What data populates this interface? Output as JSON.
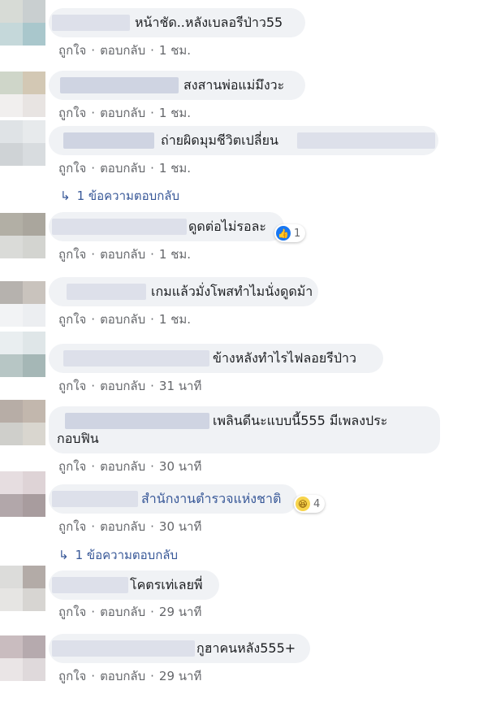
{
  "actions": {
    "like": "ถูกใจ",
    "reply": "ตอบกลับ",
    "sep": "·"
  },
  "comments": [
    {
      "text": "หน้าชัด..หลังเบลอรีป่าว55",
      "time": "1 ชม."
    },
    {
      "text": "สงสานพ่อแม่มึงวะ",
      "time": "1 ชม."
    },
    {
      "text": "ถ่ายผิดมุมชีวิตเปลี่ยน",
      "time": "1 ชม.",
      "replies": "1 ข้อความตอบกลับ"
    },
    {
      "text": "ดูดต่อไม่รอละ",
      "time": "1 ชม.",
      "reaction": {
        "icon": "like-icon",
        "count": "1"
      }
    },
    {
      "text": "เกมแล้วมั่งโพสทำไมนั่งดูดม้า",
      "time": "1 ชม."
    },
    {
      "text": "ข้างหลังทำไรไฟลอยรีป่าว",
      "time": "31 นาที"
    },
    {
      "text_line1": "เพลินดีนะแบบนี้555 มีเพลงประ",
      "text_line2": "กอบฟิน",
      "time": "30 นาที"
    },
    {
      "text": "สำนักงานตำรวจแห่งชาติ",
      "time": "30 นาที",
      "reaction": {
        "icon": "haha-icon",
        "count": "4"
      },
      "replies": "1 ข้อความตอบกลับ"
    },
    {
      "text": "โคตรเท่เลยพี่",
      "time": "29 นาที"
    },
    {
      "text": "กูฮาคนหลัง555+",
      "time": "29 นาที"
    }
  ],
  "colors": {
    "bubble": "#f0f2f5",
    "link": "#385898",
    "meta": "#65676b",
    "like": "#1877f2"
  }
}
